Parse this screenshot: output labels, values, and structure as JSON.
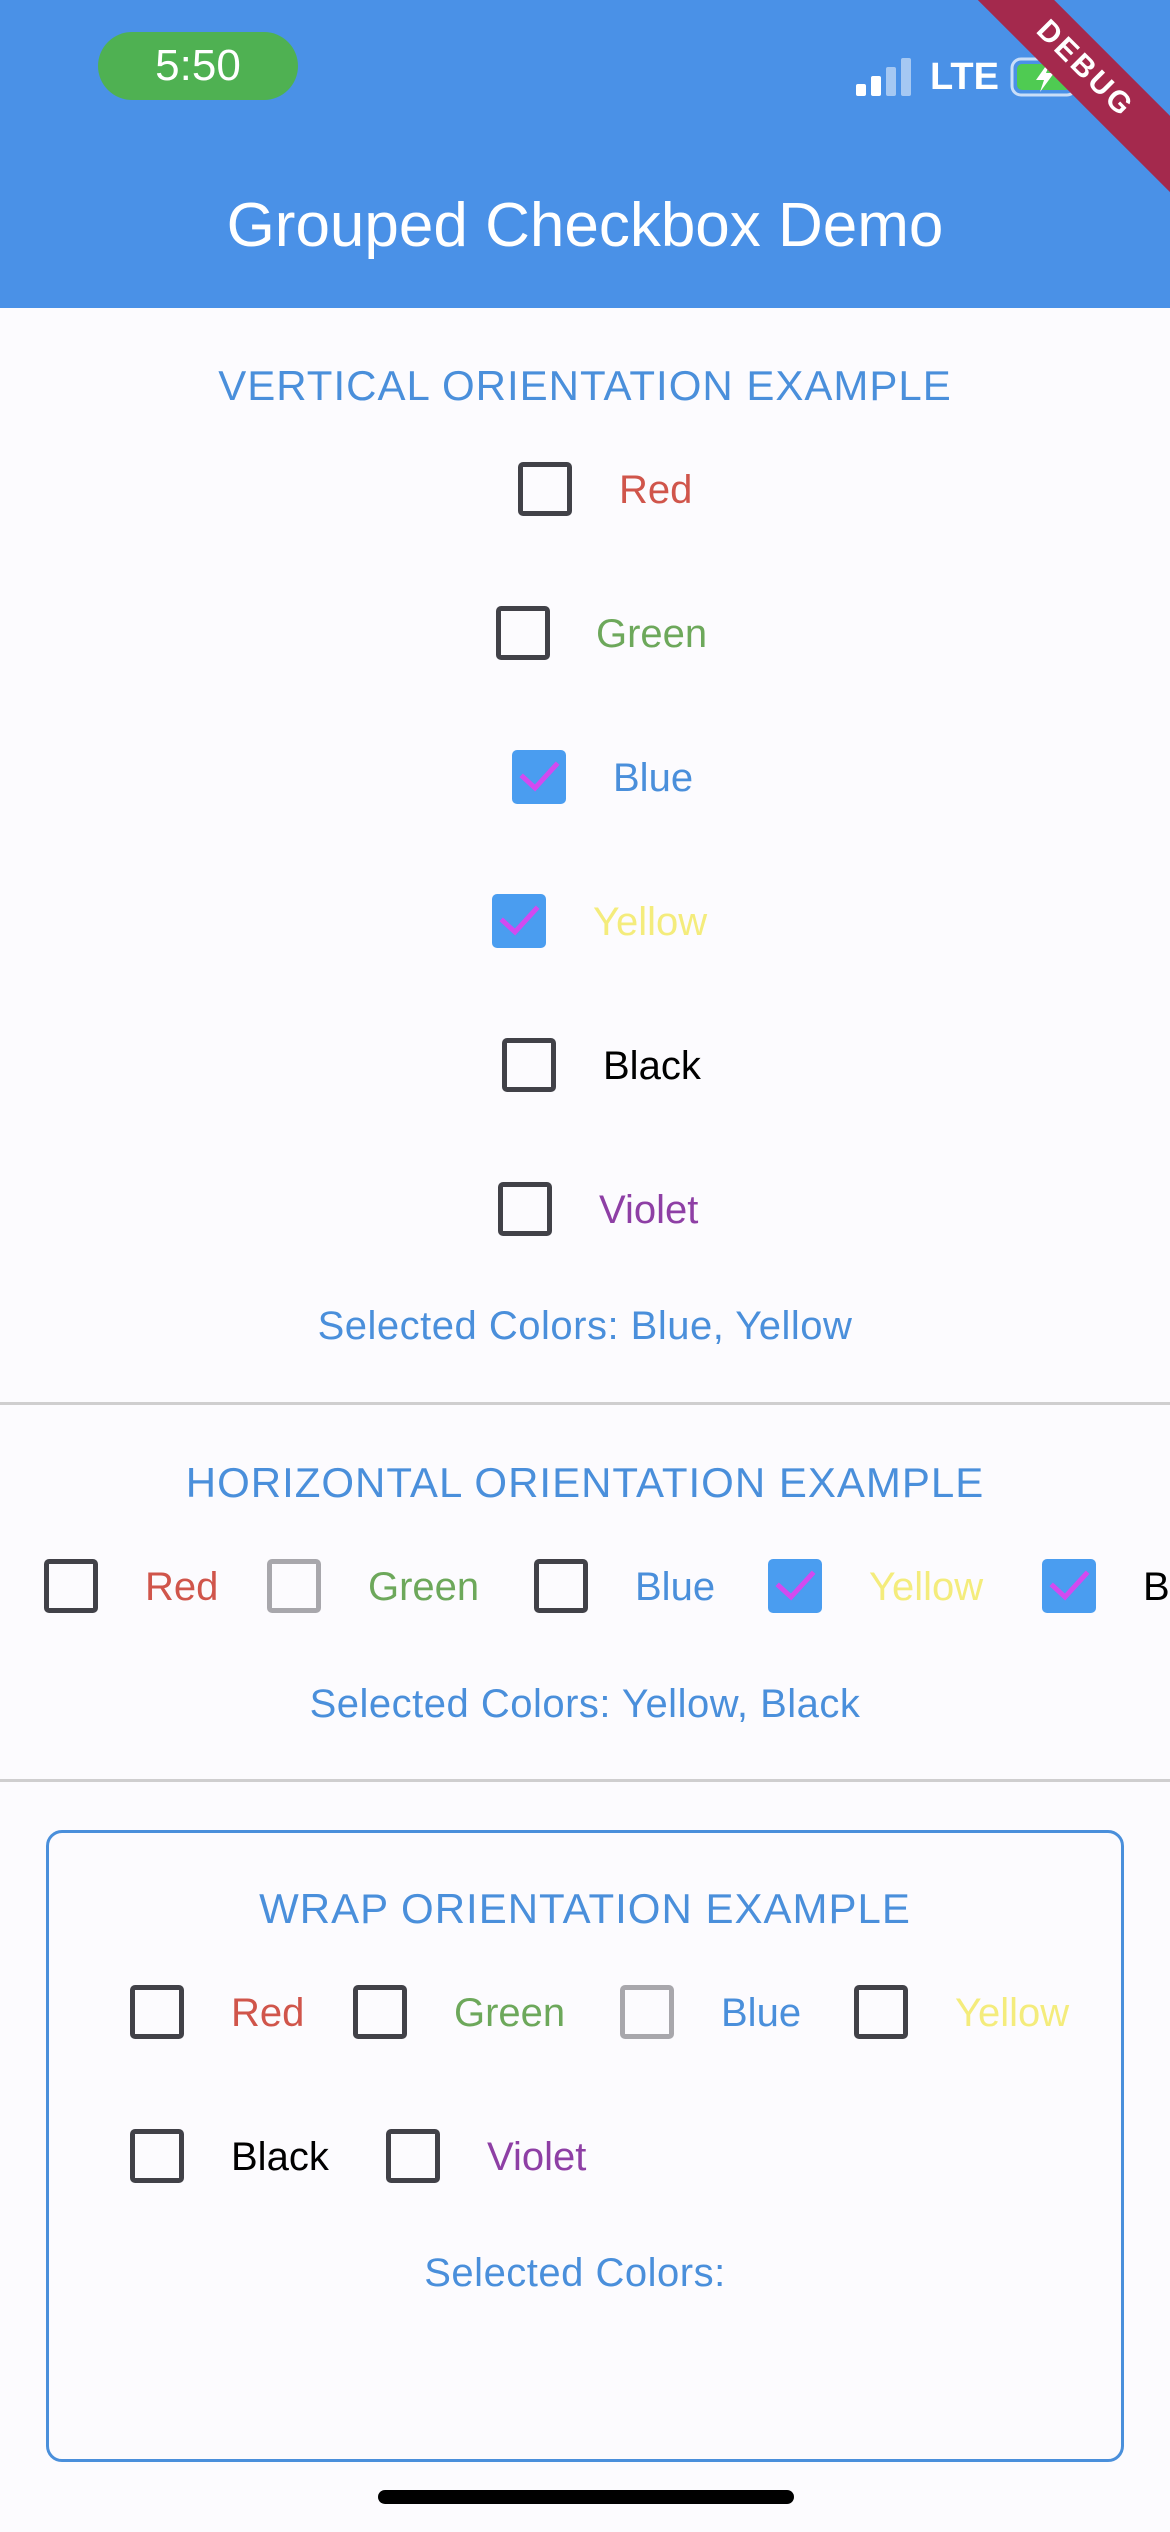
{
  "status_bar": {
    "time": "5:50",
    "network": "LTE",
    "debug_banner": "DEBUG"
  },
  "app_bar": {
    "title": "Grouped Checkbox Demo"
  },
  "colors": {
    "red": "#D0554B",
    "green": "#6DA85B",
    "blue": "#4A8FDB",
    "yellow": "#F4EC7C",
    "black": "#000000",
    "violet": "#8E3FA5",
    "check_fill": "#4A9DF0",
    "check_mark": "#D24AF0"
  },
  "vertical": {
    "title": "VERTICAL ORIENTATION EXAMPLE",
    "items": [
      {
        "label": "Red",
        "checked": false,
        "disabled": true
      },
      {
        "label": "Green",
        "checked": false,
        "disabled": false
      },
      {
        "label": "Blue",
        "checked": true,
        "disabled": false
      },
      {
        "label": "Yellow",
        "checked": true,
        "disabled": false
      },
      {
        "label": "Black",
        "checked": false,
        "disabled": false
      },
      {
        "label": "Violet",
        "checked": false,
        "disabled": false
      }
    ],
    "selected_text": "Selected Colors: Blue, Yellow"
  },
  "horizontal": {
    "title": "HORIZONTAL ORIENTATION EXAMPLE",
    "items": [
      {
        "label": "Red",
        "checked": false,
        "disabled": false
      },
      {
        "label": "Green",
        "checked": false,
        "disabled": true
      },
      {
        "label": "Blue",
        "checked": false,
        "disabled": false
      },
      {
        "label": "Yellow",
        "checked": true,
        "disabled": false
      },
      {
        "label": "B",
        "checked": true,
        "disabled": false
      }
    ],
    "selected_text": "Selected Colors: Yellow, Black"
  },
  "wrap": {
    "title": "WRAP ORIENTATION EXAMPLE",
    "items": [
      {
        "label": "Red",
        "checked": false,
        "disabled": false
      },
      {
        "label": "Green",
        "checked": false,
        "disabled": false
      },
      {
        "label": "Blue",
        "checked": false,
        "disabled": true
      },
      {
        "label": "Yellow",
        "checked": false,
        "disabled": false
      },
      {
        "label": "Black",
        "checked": false,
        "disabled": false
      },
      {
        "label": "Violet",
        "checked": false,
        "disabled": false
      }
    ],
    "selected_text": "Selected Colors:"
  }
}
